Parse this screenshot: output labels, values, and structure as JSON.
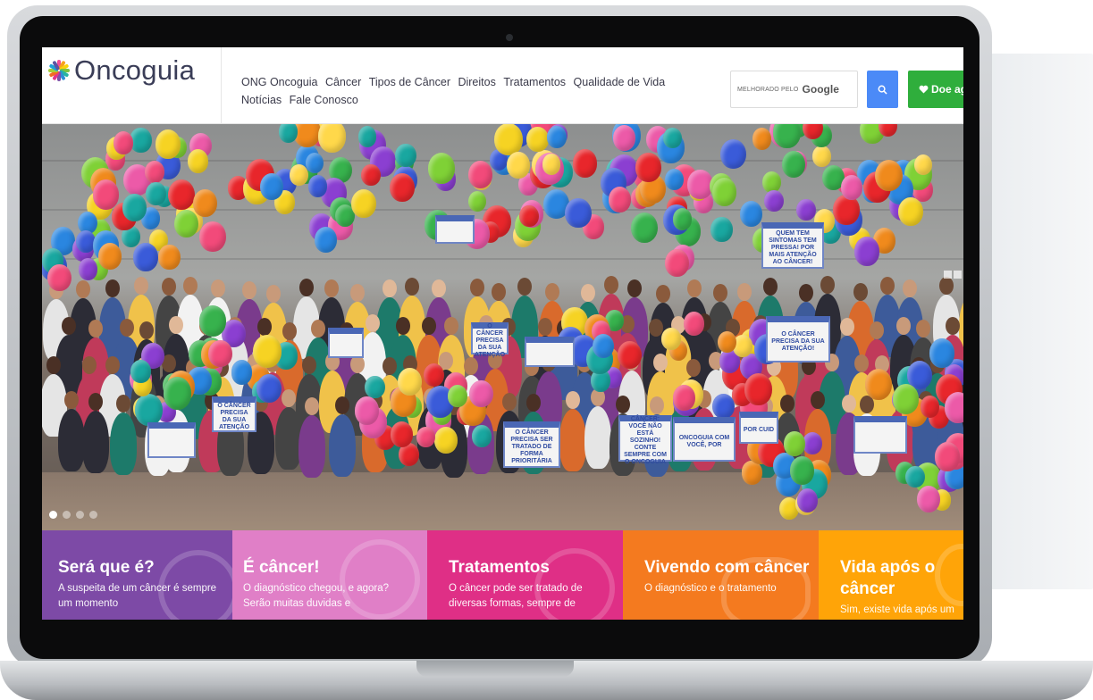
{
  "brand": {
    "logo_text": "Oncoguia"
  },
  "nav": {
    "items": [
      "ONG Oncoguia",
      "Câncer",
      "Tipos de Câncer",
      "Direitos",
      "Tratamentos",
      "Qualidade de Vida",
      "Notícias",
      "Fale Conosco"
    ]
  },
  "search": {
    "powered_by": "MELHORADO PELO",
    "provider": "Google"
  },
  "donate": {
    "label": "Doe ag"
  },
  "hero": {
    "signs": [
      "O CÂNCER PRECISA DA SUA ATENÇÃO!",
      "QUEM TEM SINTOMAS TEM PRESSA! POR MAIS ATENÇÃO AO CÂNCER!",
      "O CÂNCER PRECISA SER TRATADO DE FORMA PRIORITÁRIA",
      "ONCOGUIA COM VOCÊ, POR",
      "CÂNCER: VOCÊ NÃO ESTÁ SOZINHO! CONTE SEMPRE COM O ONCOGUIA",
      "POR CUID",
      "O CÂNCER PRECISA DA SUA ATENÇÃO",
      "O CÂNCER PRECISA DA SUA ATENÇÃO"
    ]
  },
  "tiles": [
    {
      "title": "Será que é?",
      "text": "A suspeita de um câncer é sempre um momento",
      "color": "#7d4aa6"
    },
    {
      "title": "É câncer!",
      "text": "O diagnóstico chegou, e agora? Serão muitas duvidas e",
      "color": "#e07fc7"
    },
    {
      "title": "Tratamentos",
      "text": "O câncer pode ser tratado de diversas formas, sempre de",
      "color": "#df2f86"
    },
    {
      "title": "Vivendo com câncer",
      "text": "O diagnóstico e o tratamento",
      "color": "#f47a1f"
    },
    {
      "title": "Vida após o câncer",
      "text": "Sim, existe vida após um",
      "color": "#ffa408"
    }
  ],
  "colors": {
    "accent_blue": "#4b8af7",
    "donate_green": "#2fae3c"
  },
  "icons": [
    "oncoguia-logo-icon",
    "search-icon",
    "heart-icon"
  ]
}
